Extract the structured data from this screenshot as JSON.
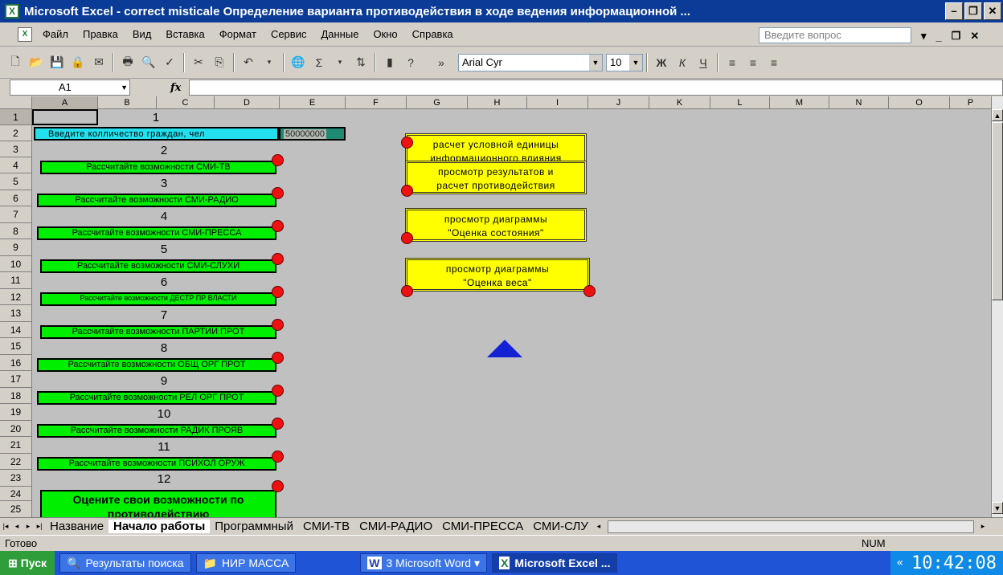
{
  "titlebar": {
    "title": "Microsoft Excel - correct misticale Определение варианта противодействия в ходе ведения информационной ..."
  },
  "menu": {
    "items": [
      "Файл",
      "Правка",
      "Вид",
      "Вставка",
      "Формат",
      "Сервис",
      "Данные",
      "Окно",
      "Справка"
    ],
    "help_placeholder": "Введите вопрос"
  },
  "toolbar": {
    "font": "Arial Cyr",
    "size": "10",
    "bold": "Ж",
    "italic": "К",
    "underline": "Ч"
  },
  "formula": {
    "cell": "A1",
    "fx": "fx"
  },
  "columns": [
    "A",
    "B",
    "C",
    "D",
    "E",
    "F",
    "G",
    "H",
    "I",
    "J",
    "K",
    "L",
    "M",
    "N",
    "O",
    "P"
  ],
  "rows": [
    "1",
    "2",
    "3",
    "4",
    "5",
    "6",
    "7",
    "8",
    "9",
    "10",
    "11",
    "12",
    "13",
    "14",
    "15",
    "16",
    "17",
    "18",
    "19",
    "20",
    "21",
    "22",
    "23",
    "24",
    "25"
  ],
  "sheet": {
    "input_label": "Введите колличество граждан, чел",
    "input_value": "50000000",
    "numbers": [
      "1",
      "2",
      "3",
      "4",
      "5",
      "6",
      "7",
      "8",
      "9",
      "10",
      "11",
      "12"
    ],
    "green_buttons": [
      "Рассчитайте возможности СМИ-ТВ",
      "Рассчитайте возможности СМИ-РАДИО",
      "Рассчитайте возможности СМИ-ПРЕССА",
      "Рассчитайте возможности СМИ-СЛУХИ",
      "Рассчитайте возможности ДЕСТР ПР ВЛАСТИ",
      "Рассчитайте возможности ПАРТИИ ПРОТ",
      "Рассчитайте возможности ОБЩ ОРГ ПРОТ",
      "Рассчитайте возможности РЕЛ ОРГ ПРОТ",
      "Рассчитайте возможности РАДИК ПРОЯВ",
      "Рассчитайте возможности ПСИХОЛ ОРУЖ"
    ],
    "big_button": "Оцените свои возможности по противодействию",
    "yellow_buttons": [
      {
        "line1": "расчет условной единицы",
        "line2": "информационного влияния"
      },
      {
        "line1": "просмотр результатов и",
        "line2": "расчет противодействия"
      },
      {
        "line1": "просмотр диаграммы",
        "line2": "\"Оценка состояния\""
      },
      {
        "line1": "просмотр диаграммы",
        "line2": "\"Оценка веса\""
      }
    ]
  },
  "tabs": [
    "Название",
    "Начало работы",
    "Программный",
    "СМИ-ТВ",
    "СМИ-РАДИО",
    "СМИ-ПРЕССА",
    "СМИ-СЛУ"
  ],
  "status": {
    "left": "Готово",
    "num": "NUM"
  },
  "taskbar": {
    "start": "Пуск",
    "tasks": [
      "Результаты поиска",
      "НИР МАССА",
      "3 Microsoft Word",
      "Microsoft Excel ..."
    ],
    "clock": "10:42:08",
    "tray_prefix": "«"
  }
}
